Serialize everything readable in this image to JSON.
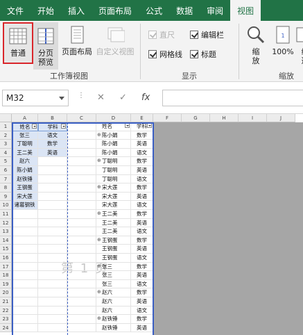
{
  "tabs": [
    "文件",
    "开始",
    "插入",
    "页面布局",
    "公式",
    "数据",
    "审阅",
    "视图"
  ],
  "active_tab_index": 7,
  "ribbon": {
    "workbook_views": {
      "group_label": "工作簿视图",
      "normal": "普通",
      "page_break_1": "分页",
      "page_break_2": "预览",
      "page_layout": "页面布局",
      "custom_views": "自定义视图"
    },
    "show": {
      "group_label": "显示",
      "ruler": "直尺",
      "formula_bar": "编辑栏",
      "gridlines": "网格线",
      "headings": "标题"
    },
    "zoom": {
      "group_label": "缩放",
      "zoom_1": "缩",
      "zoom_2": "放",
      "zoom100": "100%",
      "partial_1": "缩",
      "partial_2": "选"
    }
  },
  "formula_bar": {
    "name_box": "M32",
    "cancel": "✕",
    "enter": "✓",
    "fx": "fx"
  },
  "columns": [
    "A",
    "B",
    "C",
    "D",
    "E",
    "F",
    "G",
    "H",
    "I",
    "J"
  ],
  "rows": [
    "1",
    "2",
    "3",
    "4",
    "5",
    "6",
    "7",
    "8",
    "9",
    "10",
    "11",
    "12",
    "13",
    "14",
    "15",
    "16",
    "17",
    "18",
    "19",
    "20",
    "21",
    "22",
    "23",
    "24"
  ],
  "sheet": {
    "a_header": "姓名",
    "b_header": "学科",
    "a_values": [
      "张三",
      "丁聪明",
      "王二美",
      "赵六",
      "陈小娟",
      "赵铁锤",
      "王钢蛋",
      "宋大莲",
      "诸葛钢铁"
    ],
    "b_values": [
      "语文",
      "数学",
      "英语"
    ],
    "d_header": "姓名",
    "e_header": "学科",
    "d_values": [
      "陈小娟",
      "陈小娟",
      "陈小娟",
      "丁聪明",
      "丁聪明",
      "丁聪明",
      "宋大莲",
      "宋大莲",
      "宋大莲",
      "王二美",
      "王二美",
      "王二美",
      "王钢蛋",
      "王钢蛋",
      "王钢蛋",
      "张三",
      "张三",
      "张三",
      "赵六",
      "赵六",
      "赵六",
      "赵铁锤",
      "赵铁锤"
    ],
    "e_values": [
      "数学",
      "英语",
      "语文",
      "数学",
      "英语",
      "语文",
      "数学",
      "英语",
      "语文",
      "数学",
      "英语",
      "语文",
      "数学",
      "英语",
      "语文",
      "数学",
      "英语",
      "语文",
      "数学",
      "英语",
      "语文",
      "数学",
      "英语"
    ]
  },
  "watermark": "第 1 页"
}
